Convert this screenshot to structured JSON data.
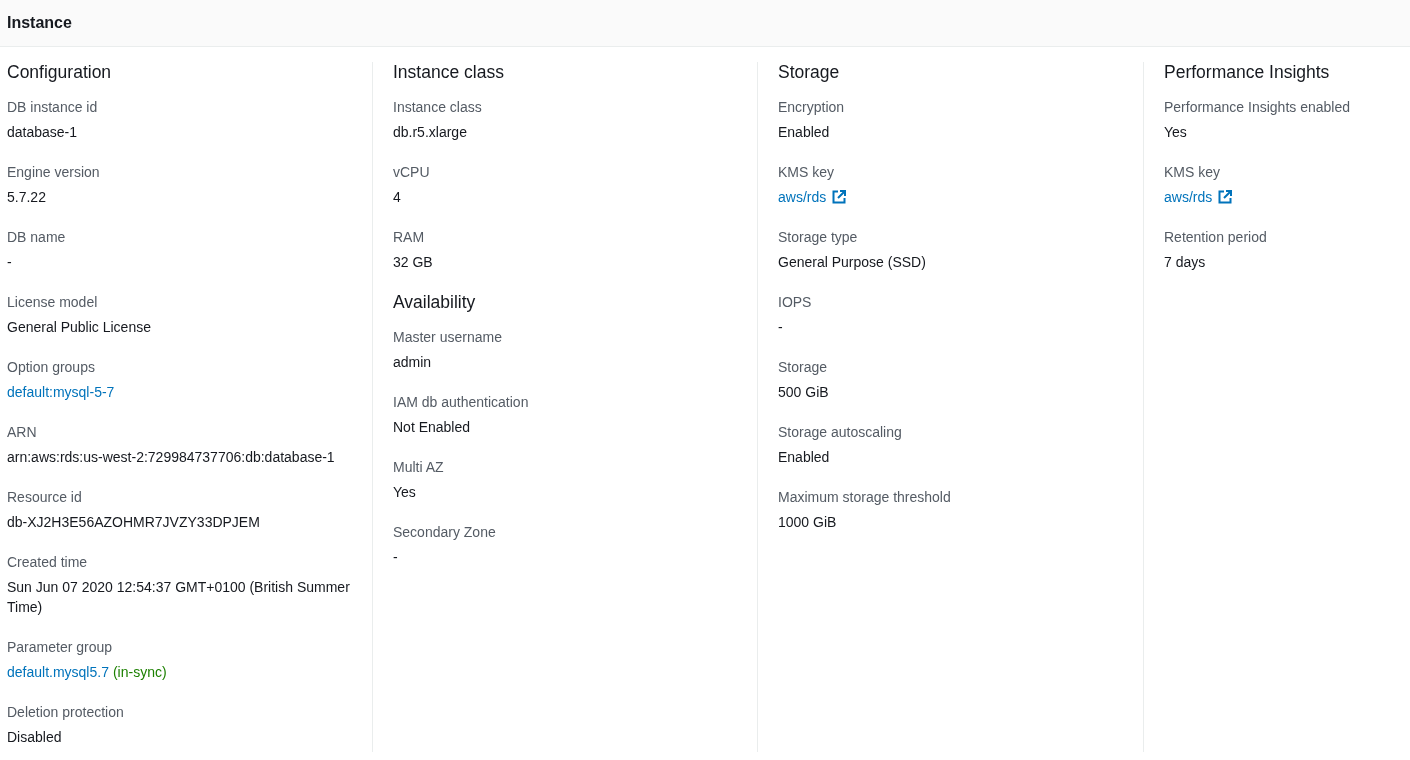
{
  "header": {
    "title": "Instance"
  },
  "columns": [
    {
      "sections": [
        {
          "title": "Configuration",
          "fields": [
            {
              "label": "DB instance id",
              "kind": "text",
              "value": "database-1"
            },
            {
              "label": "Engine version",
              "kind": "text",
              "value": "5.7.22"
            },
            {
              "label": "DB name",
              "kind": "text",
              "value": "-"
            },
            {
              "label": "License model",
              "kind": "text",
              "value": "General Public License"
            },
            {
              "label": "Option groups",
              "kind": "link",
              "value": "default:mysql-5-7"
            },
            {
              "label": "ARN",
              "kind": "text",
              "value": "arn:aws:rds:us-west-2:729984737706:db:database-1"
            },
            {
              "label": "Resource id",
              "kind": "text",
              "value": "db-XJ2H3E56AZOHMR7JVZY33DPJEM"
            },
            {
              "label": "Created time",
              "kind": "text",
              "value": "Sun Jun 07 2020 12:54:37 GMT+0100 (British Summer Time)"
            },
            {
              "label": "Parameter group",
              "kind": "link",
              "value": "default.mysql5.7",
              "status": "(in-sync)"
            },
            {
              "label": "Deletion protection",
              "kind": "text",
              "value": "Disabled"
            }
          ]
        }
      ]
    },
    {
      "sections": [
        {
          "title": "Instance class",
          "fields": [
            {
              "label": "Instance class",
              "kind": "text",
              "value": "db.r5.xlarge"
            },
            {
              "label": "vCPU",
              "kind": "text",
              "value": "4"
            },
            {
              "label": "RAM",
              "kind": "text",
              "value": "32 GB"
            }
          ]
        },
        {
          "title": "Availability",
          "fields": [
            {
              "label": "Master username",
              "kind": "text",
              "value": "admin"
            },
            {
              "label": "IAM db authentication",
              "kind": "text",
              "value": "Not Enabled"
            },
            {
              "label": "Multi AZ",
              "kind": "text",
              "value": "Yes"
            },
            {
              "label": "Secondary Zone",
              "kind": "text",
              "value": "-"
            }
          ]
        }
      ]
    },
    {
      "sections": [
        {
          "title": "Storage",
          "fields": [
            {
              "label": "Encryption",
              "kind": "text",
              "value": "Enabled"
            },
            {
              "label": "KMS key",
              "kind": "external_link",
              "value": "aws/rds"
            },
            {
              "label": "Storage type",
              "kind": "text",
              "value": "General Purpose (SSD)"
            },
            {
              "label": "IOPS",
              "kind": "text",
              "value": "-"
            },
            {
              "label": "Storage",
              "kind": "text",
              "value": "500 GiB"
            },
            {
              "label": "Storage autoscaling",
              "kind": "text",
              "value": "Enabled"
            },
            {
              "label": "Maximum storage threshold",
              "kind": "text",
              "value": "1000 GiB"
            }
          ]
        }
      ]
    },
    {
      "sections": [
        {
          "title": "Performance Insights",
          "fields": [
            {
              "label": "Performance Insights enabled",
              "kind": "text",
              "value": "Yes"
            },
            {
              "label": "KMS key",
              "kind": "external_link",
              "value": "aws/rds"
            },
            {
              "label": "Retention period",
              "kind": "text",
              "value": "7 days"
            }
          ]
        }
      ]
    }
  ]
}
